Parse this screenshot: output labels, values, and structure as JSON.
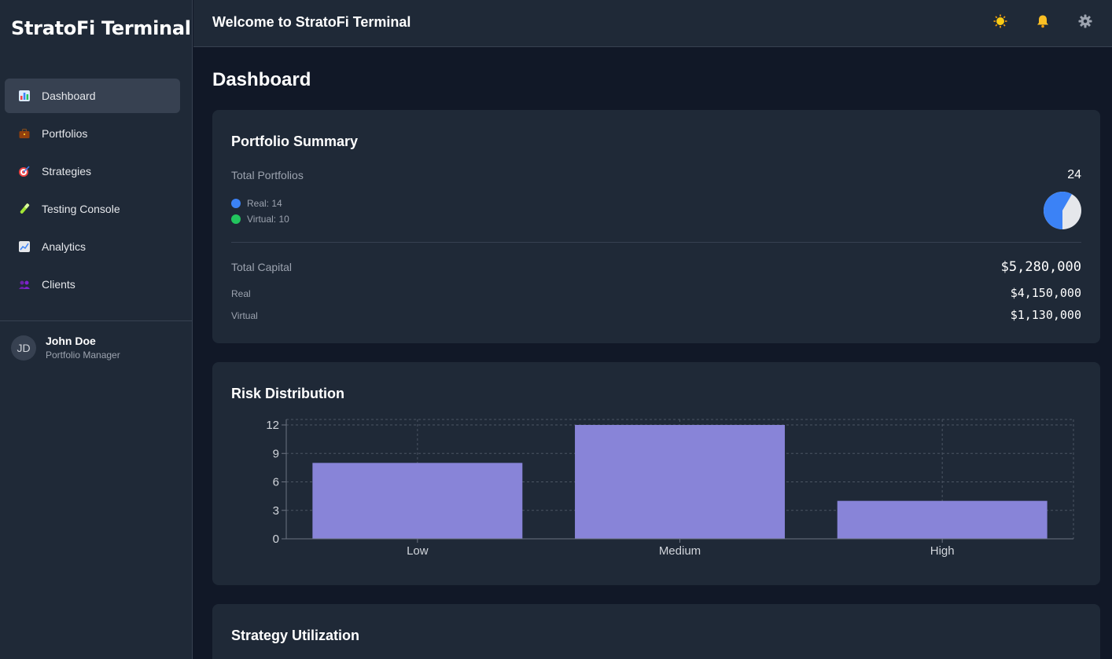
{
  "app": {
    "brand": "StratoFi Terminal",
    "welcome": "Welcome to StratoFi Terminal"
  },
  "sidebar": {
    "items": [
      {
        "label": "Dashboard",
        "icon": "bar-chart-icon",
        "active": true
      },
      {
        "label": "Portfolios",
        "icon": "briefcase-icon"
      },
      {
        "label": "Strategies",
        "icon": "target-icon"
      },
      {
        "label": "Testing Console",
        "icon": "test-tube-icon"
      },
      {
        "label": "Analytics",
        "icon": "trend-chart-icon"
      },
      {
        "label": "Clients",
        "icon": "people-icon"
      }
    ],
    "user": {
      "initials": "JD",
      "name": "John Doe",
      "role": "Portfolio Manager"
    }
  },
  "header": {
    "icons": [
      "sun-icon",
      "bell-icon",
      "gear-icon"
    ]
  },
  "main": {
    "title": "Dashboard",
    "summary": {
      "title": "Portfolio Summary",
      "total_portfolios_label": "Total Portfolios",
      "total_portfolios_value": "24",
      "real_legend": "Real: 14",
      "virtual_legend": "Virtual: 10",
      "real_count": 14,
      "virtual_count": 10,
      "total_capital_label": "Total Capital",
      "total_capital_value": "$5,280,000",
      "real_label": "Real",
      "real_value": "$4,150,000",
      "virtual_label": "Virtual",
      "virtual_value": "$1,130,000"
    },
    "risk": {
      "title": "Risk Distribution"
    },
    "strategy": {
      "title": "Strategy Utilization"
    }
  },
  "colors": {
    "real": "#3b82f6",
    "virtual": "#22c55e",
    "pie_rest": "#e5e7eb",
    "bar": "#8884d8",
    "sun": "#facc15",
    "bell": "#fbbf24",
    "gear": "#9ca3af"
  },
  "chart_data": {
    "type": "bar",
    "categories": [
      "Low",
      "Medium",
      "High"
    ],
    "values": [
      8,
      12,
      4
    ],
    "ylim": [
      0,
      12
    ],
    "yticks": [
      0,
      3,
      6,
      9,
      12
    ],
    "grid": true,
    "title": "",
    "xlabel": "",
    "ylabel": ""
  }
}
